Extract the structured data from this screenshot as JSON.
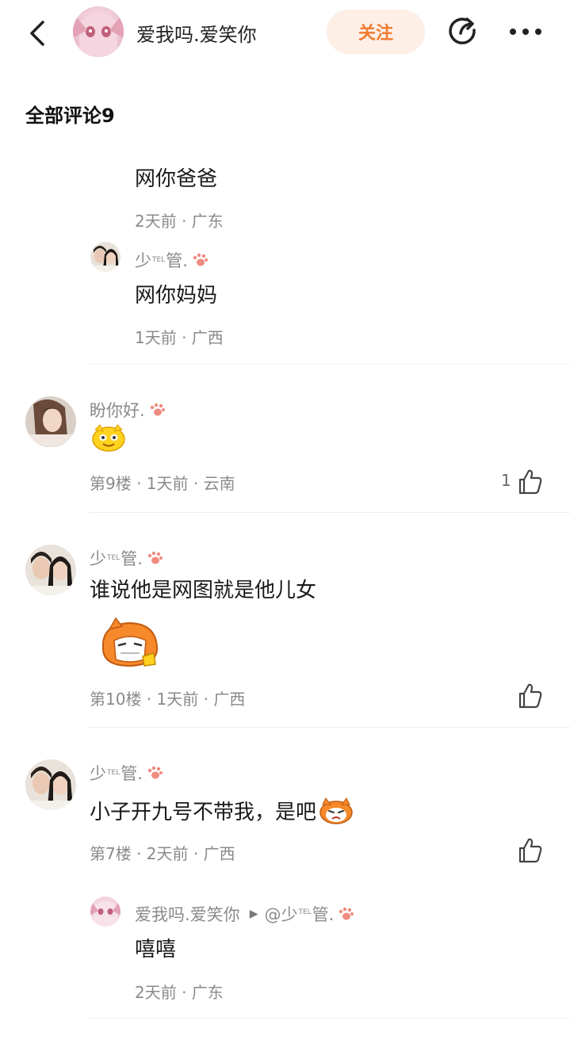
{
  "header": {
    "author_name": "爱我吗.爱笑你",
    "follow_label": "关注"
  },
  "comments_section": {
    "title": "全部评论9"
  },
  "reply_a": {
    "text": "网你爸爸",
    "meta": "2天前 · 广东"
  },
  "reply_b": {
    "user_prefix": "少",
    "user_sup": "TEL",
    "user_suffix": "管.",
    "text": "网你妈妈",
    "meta": "1天前 · 广西"
  },
  "comment_9": {
    "user": "盼你好.",
    "meta": "第9楼 · 1天前 · 云南",
    "like_count": "1"
  },
  "comment_10": {
    "user_prefix": "少",
    "user_sup": "TEL",
    "user_suffix": "管.",
    "text": "谁说他是网图就是他儿女",
    "meta": "第10楼 · 1天前 · 广西"
  },
  "comment_7": {
    "user_prefix": "少",
    "user_sup": "TEL",
    "user_suffix": "管.",
    "text": "小子开九号不带我，是吧",
    "meta": "第7楼 · 2天前 · 广西"
  },
  "reply_c": {
    "user": "爱我吗.爱笑你",
    "arrow": "▶",
    "mention_prefix": "@少",
    "mention_sup": "TEL",
    "mention_suffix": "管.",
    "text": "嘻嘻",
    "meta": "2天前 · 广东"
  },
  "colors": {
    "accent": "#f07b2f",
    "follow_bg": "#fdeee6",
    "meta_text": "#8a8a8a",
    "paw": "#f08b80"
  }
}
